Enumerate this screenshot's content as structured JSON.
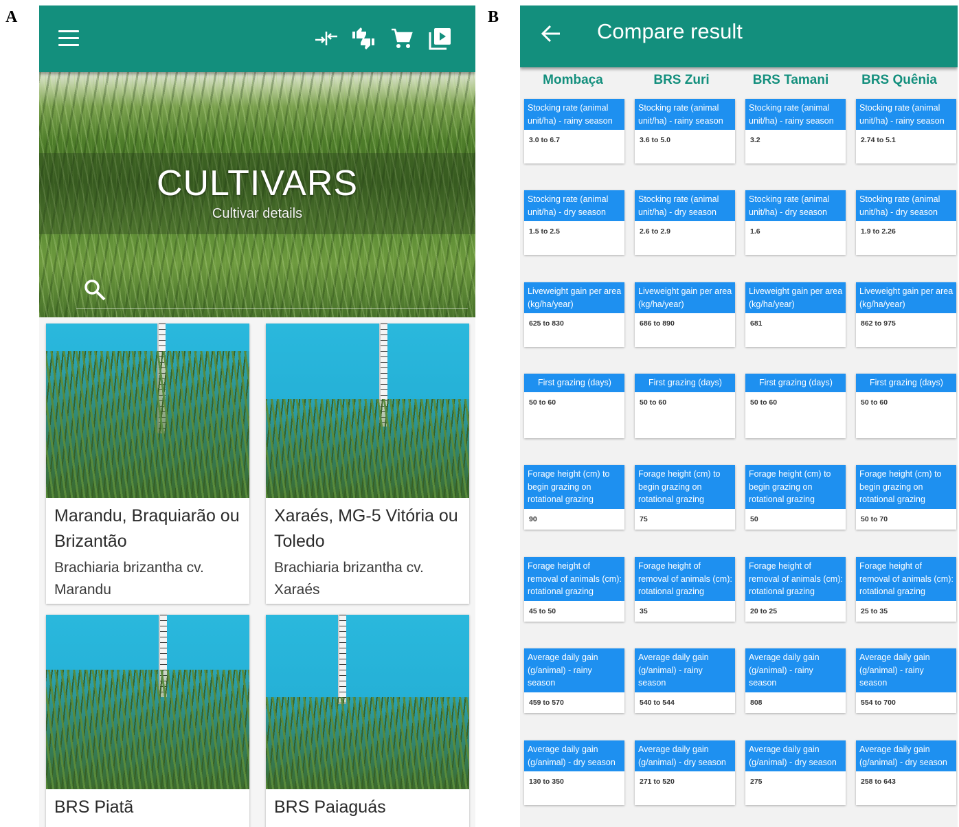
{
  "panel_letters": {
    "a": "A",
    "b": "B"
  },
  "panel_a": {
    "toolbar_icons": [
      "menu-icon",
      "compare-icon",
      "thumbs-icon",
      "cart-icon",
      "video-icon"
    ],
    "hero": {
      "title": "CULTIVARS",
      "subtitle": "Cultivar details"
    },
    "cards": [
      {
        "title": "Marandu, Braquiarão ou Brizantão",
        "subtitle": "Brachiaria brizantha cv. Marandu"
      },
      {
        "title": "Xaraés, MG-5 Vitória ou Toledo",
        "subtitle": "Brachiaria brizantha cv. Xaraés"
      },
      {
        "title": "BRS Piatã",
        "subtitle": ""
      },
      {
        "title": "BRS Paiaguás",
        "subtitle": ""
      }
    ]
  },
  "panel_b": {
    "title": "Compare result",
    "columns": [
      "Mombaça",
      "BRS Zuri",
      "BRS Tamani",
      "BRS Quênia"
    ],
    "rows": [
      {
        "label": "Stocking rate (animal unit/ha) - rainy season",
        "values": [
          "3.0 to 6.7",
          "3.6 to 5.0",
          "3.2",
          "2.74 to 5.1"
        ]
      },
      {
        "label": "Stocking rate (animal unit/ha) - dry season",
        "values": [
          "1.5 to 2.5",
          "2.6 to 2.9",
          "1.6",
          "1.9 to 2.26"
        ]
      },
      {
        "label": "Liveweight gain per area (kg/ha/year)",
        "values": [
          "625 to 830",
          "686 to 890",
          "681",
          "862 to 975"
        ]
      },
      {
        "label": "First grazing (days)",
        "values": [
          "50 to 60",
          "50 to 60",
          "50 to 60",
          "50 to 60"
        ]
      },
      {
        "label": "Forage height (cm) to begin grazing on rotational grazing",
        "values": [
          "90",
          "75",
          "50",
          "50 to 70"
        ]
      },
      {
        "label": "Forage height of removal of animals (cm): rotational grazing",
        "values": [
          "45 to 50",
          "35",
          "20 to 25",
          "25 to 35"
        ]
      },
      {
        "label": "Average daily gain (g/animal) - rainy season",
        "values": [
          "459 to 570",
          "540 to 544",
          "808",
          "554 to 700"
        ]
      },
      {
        "label": "Average daily gain (g/animal) - dry season",
        "values": [
          "130 to 350",
          "271 to 520",
          "275",
          "258 to 643"
        ]
      }
    ]
  }
}
